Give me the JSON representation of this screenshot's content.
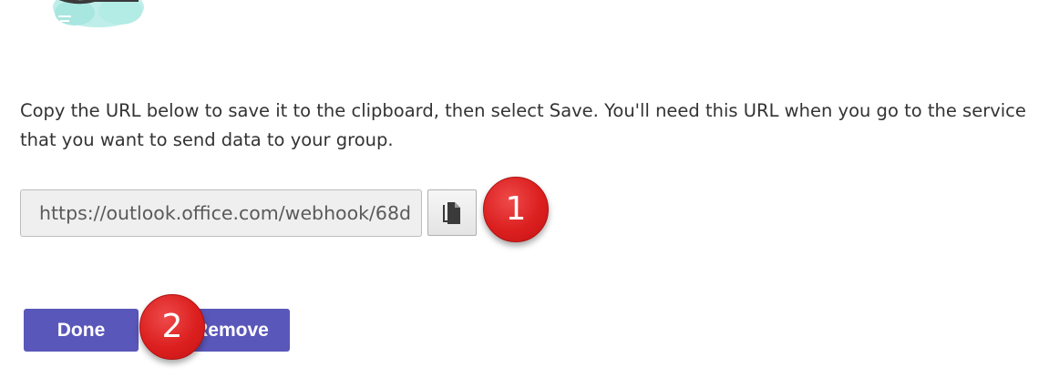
{
  "dialog": {
    "description": "Copy the URL below to save it to the clipboard, then select Save. You'll need this URL when you go to the service that you want to send data to your group.",
    "webhook_url": "https://outlook.office.com/webhook/68d",
    "copy_icon": "copy-icon"
  },
  "buttons": {
    "done_label": "Done",
    "remove_label": "Remove"
  },
  "annotations": {
    "step1": "1",
    "step2": "2"
  },
  "colors": {
    "primary_button": "#5a57ba",
    "marker_red": "#dc1f1f",
    "logo_accent": "#7fd9d3"
  }
}
